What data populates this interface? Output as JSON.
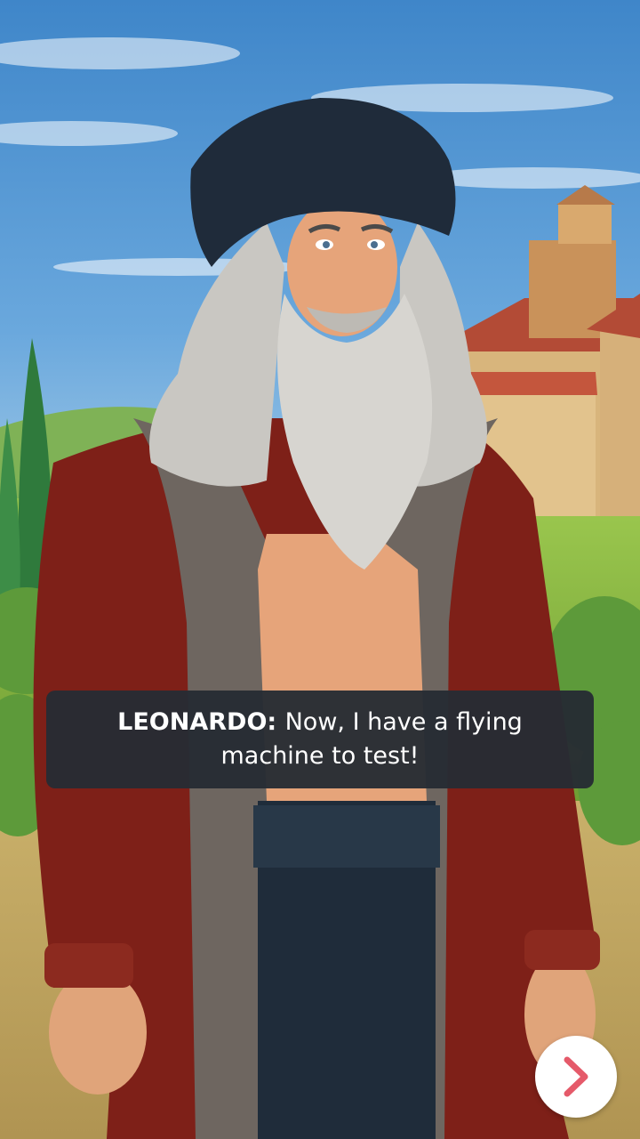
{
  "scene": {
    "setting": "tuscan-countryside",
    "character": "leonardo"
  },
  "dialog": {
    "speaker": "LEONARDO:",
    "text": "Now, I have a flying machine to test!"
  },
  "controls": {
    "next_icon": "chevron-right-icon",
    "accent_color": "#e55a6a"
  }
}
